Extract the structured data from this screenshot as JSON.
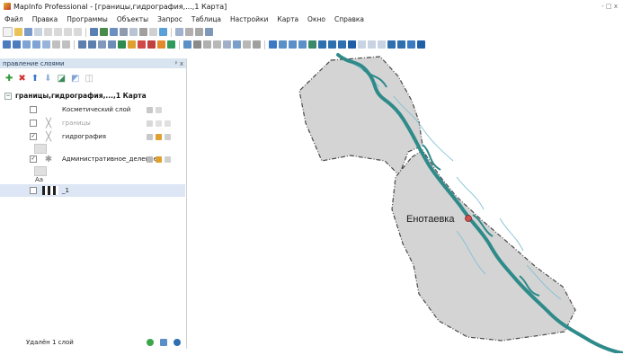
{
  "window": {
    "title": "MapInfo Professional - [границы,гидрография,...,1 Карта]",
    "controls": "- □ x"
  },
  "menu": [
    "Файл",
    "Правка",
    "Программы",
    "Объекты",
    "Запрос",
    "Таблица",
    "Настройки",
    "Карта",
    "Окно",
    "Справка"
  ],
  "layer_panel": {
    "title": "правление слоями",
    "close_label": "ᵖ x",
    "root_label": "границы,гидрография,...,1 Карта",
    "layers": [
      {
        "name": "Косметический слой",
        "checked": false,
        "dimmed": false
      },
      {
        "name": "границы",
        "checked": false,
        "dimmed": true
      },
      {
        "name": "гидрография",
        "checked": true,
        "dimmed": false
      },
      {
        "name": "Административное_деление",
        "checked": true,
        "dimmed": false,
        "legend_text": "Aa"
      },
      {
        "name": "_1",
        "checked": false,
        "dimmed": false,
        "selected": true
      }
    ],
    "status": "Удалён 1 слой"
  },
  "map": {
    "place_label": "Енотаевка",
    "colors": {
      "region_fill": "#d4d4d4",
      "river": "#2f8a8a",
      "river_light": "#7fc1d3",
      "point": "#d05050"
    }
  }
}
